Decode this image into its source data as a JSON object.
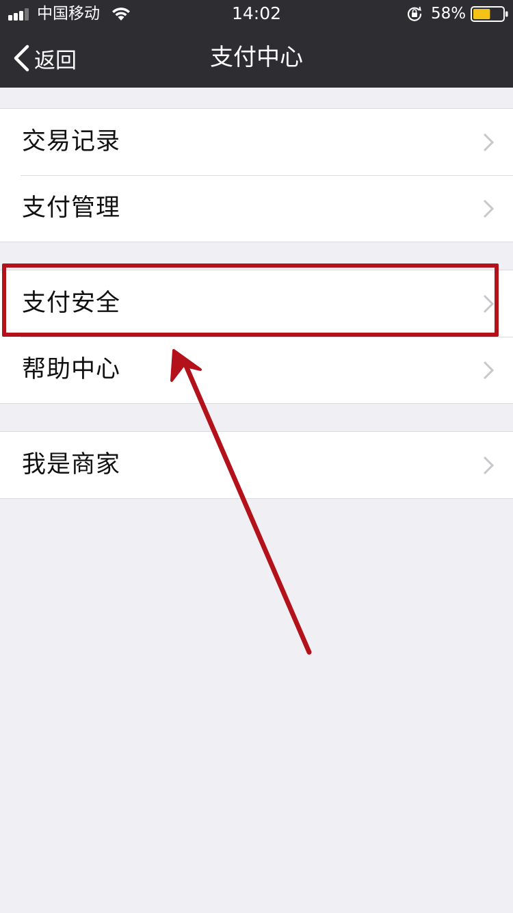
{
  "status_bar": {
    "carrier": "中国移动",
    "time": "14:02",
    "battery_percent": "58%",
    "battery_level": 0.58,
    "icons": [
      "signal-icon",
      "wifi-icon",
      "rotation-lock-icon",
      "battery-icon"
    ]
  },
  "nav": {
    "back_label": "返回",
    "title": "支付中心"
  },
  "groups": [
    {
      "items": [
        {
          "label": "交易记录"
        },
        {
          "label": "支付管理"
        }
      ]
    },
    {
      "items": [
        {
          "label": "支付安全"
        },
        {
          "label": "帮助中心"
        }
      ]
    },
    {
      "items": [
        {
          "label": "我是商家"
        }
      ]
    }
  ],
  "colors": {
    "nav_background": "#2e2d32",
    "page_background": "#efeff4",
    "annotation_red": "#b3121a",
    "battery_fill": "#f4c316",
    "chevron": "#c7c7cc"
  }
}
